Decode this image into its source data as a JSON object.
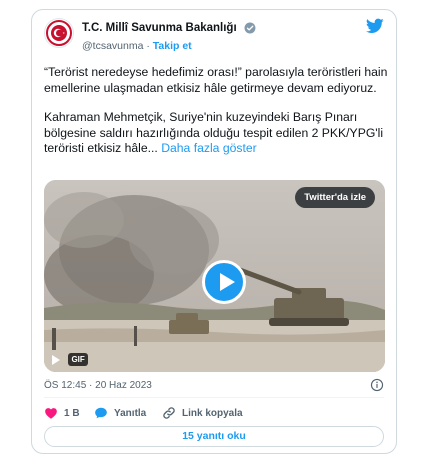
{
  "account": {
    "display_name": "T.C. Millî Savunma Bakanlığı",
    "handle": "@tcsavunma",
    "separator": "·",
    "follow_label": "Takip et"
  },
  "tweet": {
    "paragraph1": "“Terörist neredeyse hedefimiz orası!” parolasıyla teröristleri hain emellerine ulaşmadan etkisiz hâle getirmeye devam ediyoruz.",
    "paragraph2": "Kahraman Mehmetçik, Suriye'nin kuzeyindeki Barış Pınarı bölgesine saldırı hazırlığında olduğu tespit edilen 2 PKK/YPG'li teröristi etkisiz hâle...",
    "show_more": "Daha fazla göster"
  },
  "media": {
    "watch_label": "Twitter'da izle",
    "gif_label": "GIF"
  },
  "timestamp": "ÖS 12:45 · 20 Haz 2023",
  "actions": {
    "like_count": "1 B",
    "reply_label": "Yanıtla",
    "copy_link_label": "Link kopyala"
  },
  "read_replies_label": "15 yanıtı oku",
  "colors": {
    "accent": "#1d9bf0",
    "like": "#f91880",
    "text": "#0f1419",
    "muted": "#536471"
  }
}
